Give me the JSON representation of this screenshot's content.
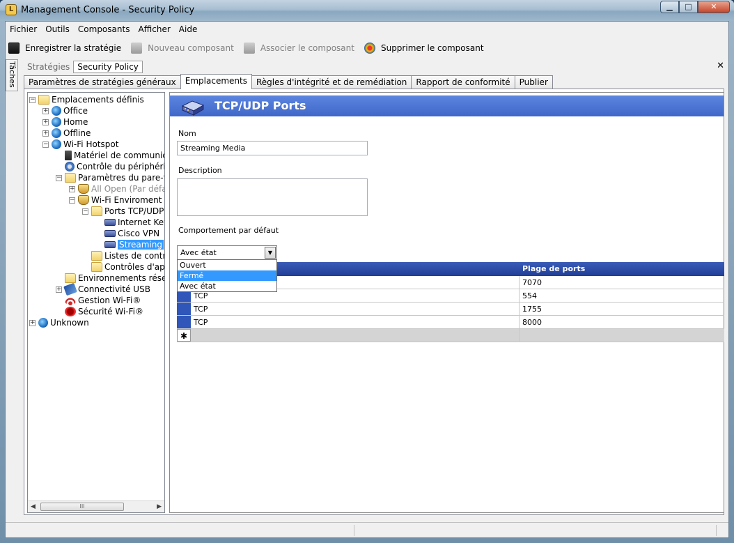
{
  "window": {
    "title": "Management Console  - Security Policy"
  },
  "menu": [
    "Fichier",
    "Outils",
    "Composants",
    "Afficher",
    "Aide"
  ],
  "toolbar": {
    "save": "Enregistrer la stratégie",
    "new_component": "Nouveau composant",
    "associate": "Associer le composant",
    "delete": "Supprimer le composant"
  },
  "side_tab": "Tâches",
  "doc_tabs": [
    "Stratégies",
    "Security Policy"
  ],
  "tabs": [
    "Paramètres de stratégies généraux",
    "Emplacements",
    "Règles d'intégrité et de remédiation",
    "Rapport de conformité",
    "Publier"
  ],
  "tree": [
    {
      "label": "Emplacements définis",
      "icon": "folder-open-icon"
    },
    {
      "label": "Office",
      "icon": "globe-icon"
    },
    {
      "label": "Home",
      "icon": "globe-icon"
    },
    {
      "label": "Offline",
      "icon": "globe-icon"
    },
    {
      "label": "Wi-Fi Hotspot",
      "icon": "globe-icon"
    },
    {
      "label": "Matériel de communica",
      "icon": "network-cable-icon"
    },
    {
      "label": "Contrôle du périphériqu",
      "icon": "device-gear-icon"
    },
    {
      "label": "Paramètres du pare-fe",
      "icon": "folder-open-icon"
    },
    {
      "label": "All Open (Par défau",
      "icon": "firewall-shield-icon"
    },
    {
      "label": "Wi-Fi Enviroment",
      "icon": "firewall-shield-icon"
    },
    {
      "label": "Ports TCP/UDP",
      "icon": "folder-open-icon"
    },
    {
      "label": "Internet Key",
      "icon": "router-icon"
    },
    {
      "label": "Cisco VPN",
      "icon": "router-icon"
    },
    {
      "label": "Streaming",
      "icon": "router-icon"
    },
    {
      "label": "Listes de contrô",
      "icon": "folder-icon"
    },
    {
      "label": "Contrôles d'app",
      "icon": "folder-icon"
    },
    {
      "label": "Environnements résea",
      "icon": "folder-icon"
    },
    {
      "label": "Connectivité USB",
      "icon": "usb-icon"
    },
    {
      "label": "Gestion Wi-Fi®",
      "icon": "wifi-icon"
    },
    {
      "label": "Sécurité Wi-Fi®",
      "icon": "wifi-security-icon"
    },
    {
      "label": "Unknown",
      "icon": "globe-icon"
    }
  ],
  "scroll_thumb_text": "III",
  "panel": {
    "title": "TCP/UDP Ports",
    "name_label": "Nom",
    "name_value": "Streaming Media",
    "description_label": "Description",
    "description_value": "",
    "behavior_label": "Comportement par défaut",
    "behavior_value": "Avec état",
    "behavior_options": [
      "Ouvert",
      "Fermé",
      "Avec état"
    ],
    "behavior_highlighted": "Fermé"
  },
  "grid": {
    "columns": [
      "",
      "Plage de ports"
    ],
    "rows": [
      {
        "protocol": "",
        "range": "7070"
      },
      {
        "protocol": "TCP",
        "range": "554"
      },
      {
        "protocol": "TCP",
        "range": "1755"
      },
      {
        "protocol": "TCP",
        "range": "8000"
      }
    ],
    "new_row_marker": "✱"
  }
}
